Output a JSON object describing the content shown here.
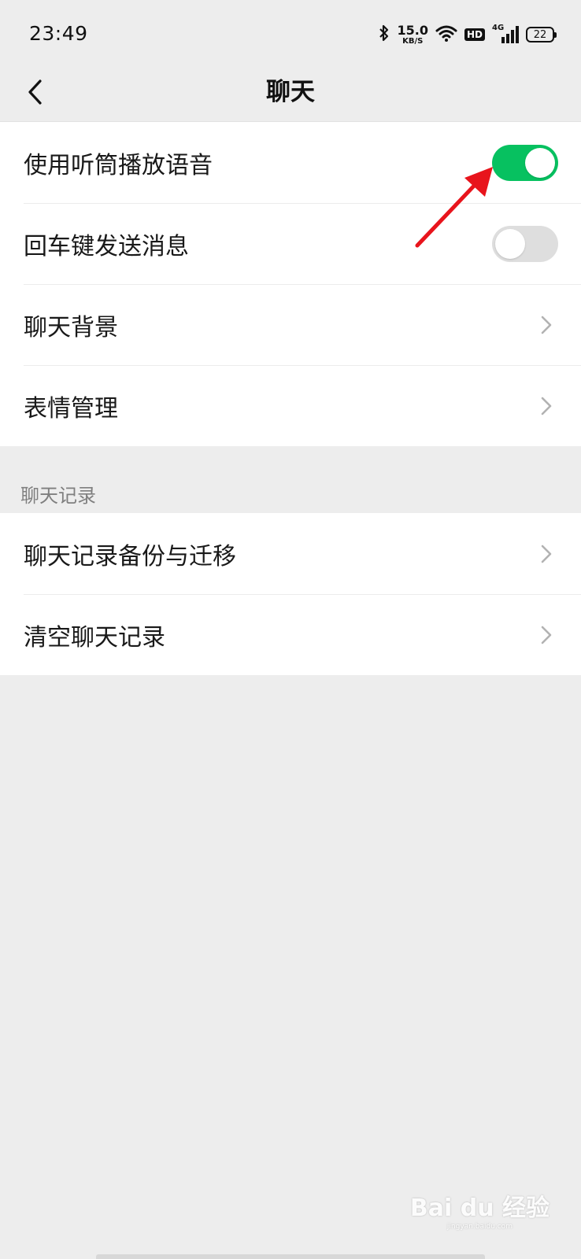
{
  "status_bar": {
    "time": "23:49",
    "speed_value": "15.0",
    "speed_unit": "KB/S",
    "hd": "HD",
    "network": "4G",
    "battery": "22"
  },
  "nav": {
    "title": "聊天"
  },
  "settings": [
    {
      "label": "使用听筒播放语音",
      "control": "toggle",
      "on": true
    },
    {
      "label": "回车键发送消息",
      "control": "toggle",
      "on": false
    },
    {
      "label": "聊天背景",
      "control": "chevron"
    },
    {
      "label": "表情管理",
      "control": "chevron"
    }
  ],
  "history": {
    "header": "聊天记录",
    "items": [
      {
        "label": "聊天记录备份与迁移",
        "control": "chevron"
      },
      {
        "label": "清空聊天记录",
        "control": "chevron"
      }
    ]
  },
  "watermark": {
    "brand": "Bai du 经验",
    "url": "jingyan.baidu.com"
  },
  "colors": {
    "toggle_on": "#07c160",
    "toggle_off": "#dedede",
    "annotation_arrow": "#e8141c",
    "background": "#ededed"
  }
}
